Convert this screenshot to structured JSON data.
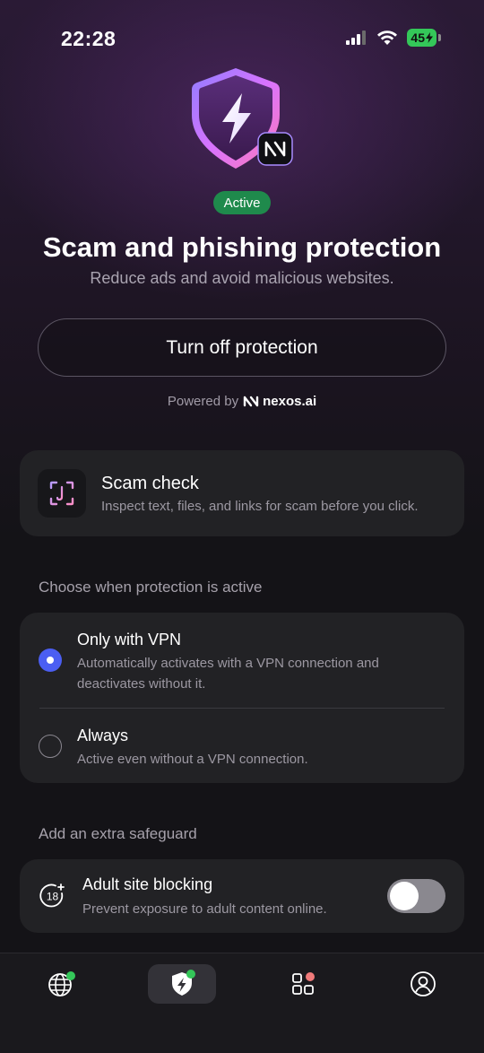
{
  "status_bar": {
    "time": "22:28",
    "battery": "45"
  },
  "hero": {
    "badge": "Active",
    "title": "Scam and phishing protection",
    "subtitle": "Reduce ads and avoid malicious websites.",
    "turn_off_label": "Turn off protection",
    "powered_by_label": "Powered by",
    "powered_by_brand": "nexos.ai"
  },
  "scam_check": {
    "title": "Scam check",
    "description": "Inspect text, files, and links for scam before you click."
  },
  "protection_mode": {
    "section_label": "Choose when protection is active",
    "options": [
      {
        "title": "Only with VPN",
        "description_line1": "Automatically activates with a VPN connection and",
        "description_line2": "deactivates without it.",
        "selected": true
      },
      {
        "title": "Always",
        "description_line1": "Active even without a VPN connection.",
        "selected": false
      }
    ]
  },
  "safeguard": {
    "section_label": "Add an extra safeguard",
    "adult_title": "Adult site blocking",
    "adult_description": "Prevent exposure to adult content online.",
    "adult_enabled": false,
    "adult_icon_text": "18"
  },
  "bottom_nav": {
    "items": [
      "globe-icon",
      "shield-bolt-icon",
      "apps-grid-icon",
      "profile-icon"
    ],
    "active_index": 1
  },
  "colors": {
    "accent_blue": "#4b5ef2",
    "active_green": "#1f8a4c",
    "status_green": "#34c759",
    "notification_red": "#f07a7a"
  }
}
